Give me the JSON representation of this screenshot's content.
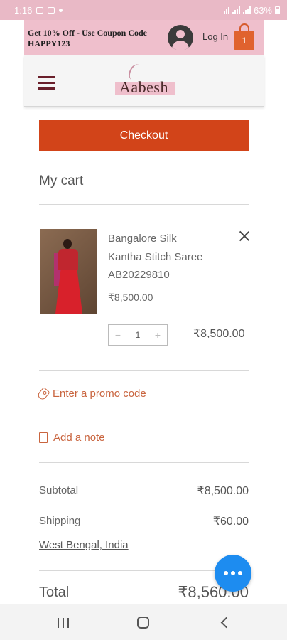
{
  "status_bar": {
    "time": "1:16",
    "battery": "63%"
  },
  "promo_bar": {
    "text": "Get 10% Off - Use Coupon Code HAPPY123",
    "login_label": "Log In",
    "cart_count": "1"
  },
  "header": {
    "logo_text": "Aabesh"
  },
  "checkout_label": "Checkout",
  "page_title": "My cart",
  "cart_item": {
    "name_lines": [
      "Bangalore Silk",
      "Kantha Stitch Saree",
      "AB20229810"
    ],
    "price": "₹8,500.00",
    "quantity": "1",
    "line_total": "₹8,500.00"
  },
  "links": {
    "promo_code": "Enter a promo code",
    "add_note": "Add a note"
  },
  "summary": {
    "subtotal_label": "Subtotal",
    "subtotal_value": "₹8,500.00",
    "shipping_label": "Shipping",
    "shipping_value": "₹60.00",
    "shipping_location": "West Bengal, India",
    "total_label": "Total",
    "total_value": "₹8,560.00"
  },
  "colors": {
    "accent": "#d24419",
    "promo_bg": "#efbfcc",
    "link": "#c9643e",
    "chat": "#1d8cf0"
  }
}
